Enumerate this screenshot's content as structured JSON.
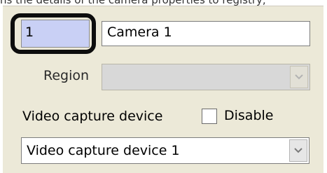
{
  "caption": {
    "text": "ns the details of the camera properties to registry,"
  },
  "camera": {
    "id_value": "1",
    "name_value": "Camera 1"
  },
  "region": {
    "label": "Region",
    "value": ""
  },
  "video_capture": {
    "label": "Video capture device",
    "disable_label": "Disable",
    "disable_checked": false,
    "selected_device": "Video capture device 1"
  },
  "icons": {
    "dropdown": "chevron-down-icon"
  },
  "colors": {
    "panel_bg": "#ece9d8",
    "id_field_bg": "#c9d0f5",
    "highlight_border": "#0d0d0d",
    "disabled_field_bg": "#d8d8d8"
  }
}
